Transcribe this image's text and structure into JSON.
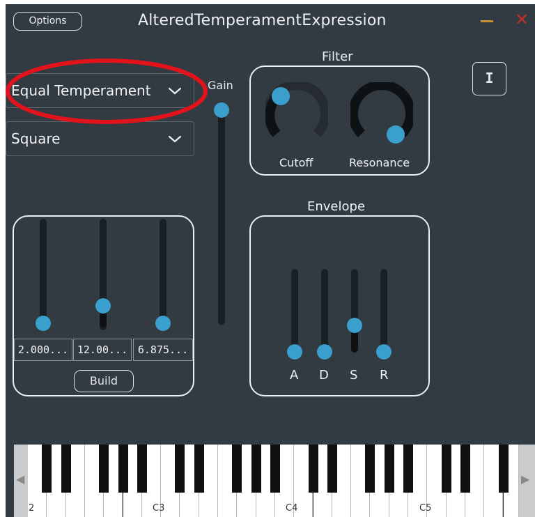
{
  "titlebar": {
    "options_label": "Options",
    "title": "AlteredTemperamentExpression"
  },
  "info_button": {
    "label": "I"
  },
  "tuning_dropdown": {
    "selected": "Equal Temperament"
  },
  "waveform_dropdown": {
    "selected": "Square"
  },
  "gain": {
    "label": "Gain"
  },
  "filter": {
    "title": "Filter",
    "cutoff_label": "Cutoff",
    "resonance_label": "Resonance"
  },
  "envelope": {
    "title": "Envelope",
    "a_label": "A",
    "d_label": "D",
    "s_label": "S",
    "r_label": "R"
  },
  "temperament": {
    "value1": "2.000...",
    "value2": "12.00...",
    "value3": "6.875...",
    "build_label": "Build"
  },
  "keyboard": {
    "partial_label": "2",
    "c3_label": "C3",
    "c4_label": "C4",
    "c5_label": "C5"
  },
  "colors": {
    "background": "#323a42",
    "accent": "#3b9fcd",
    "highlight": "#e3131c",
    "minimize": "#c8902f",
    "close": "#c0302a"
  }
}
